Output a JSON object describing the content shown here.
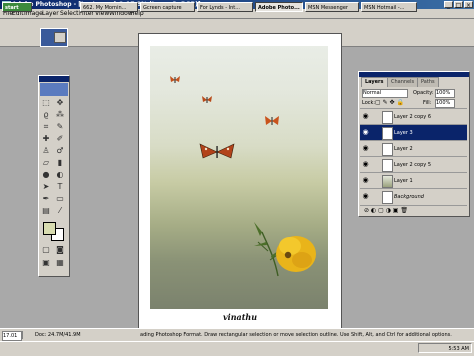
{
  "window": {
    "title": "Adobe Photoshop - [Loster.psd @ 17.8% (Layer 3, RGB)]"
  },
  "menu": [
    "File",
    "Edit",
    "Image",
    "Layer",
    "Select",
    "Filter",
    "View",
    "Window",
    "Help"
  ],
  "document": {
    "signature": "vinathu"
  },
  "layers_panel": {
    "tabs": [
      "Layers",
      "Channels",
      "Paths"
    ],
    "blend_mode": "Normal",
    "opacity_label": "Opacity:",
    "opacity_value": "100%",
    "lock_label": "Lock:",
    "fill_label": "Fill:",
    "fill_value": "100%",
    "layers": [
      {
        "name": "Layer 2 copy 6",
        "selected": false
      },
      {
        "name": "Layer 3",
        "selected": true
      },
      {
        "name": "Layer 2",
        "selected": false
      },
      {
        "name": "Layer 2 copy 5",
        "selected": false
      },
      {
        "name": "Layer 1",
        "selected": false
      },
      {
        "name": "Background",
        "selected": false
      }
    ]
  },
  "status": {
    "zoom": "17.01 %",
    "doc": "Doc: 24.7M/41.9M",
    "message": "ading Photoshop Format. Draw rectangular selection or move selection outline. Use Shift, Alt, and Ctrl for additional options."
  },
  "taskbar": {
    "start": "start",
    "items": [
      "662. My Mornin...",
      "Gcreen capture",
      "For Lynds - Int...",
      "Adobe Photo...",
      "MSN Messenger",
      "MSN Hotmail -..."
    ],
    "active_index": 3,
    "clock": "5:53 AM"
  }
}
